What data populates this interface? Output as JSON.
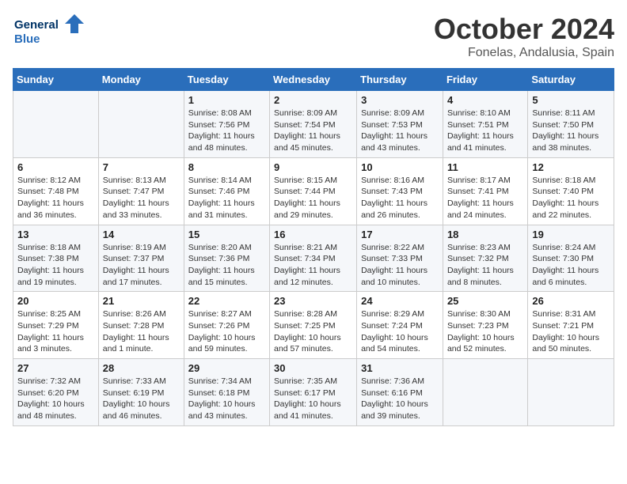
{
  "logo": {
    "line1": "General",
    "line2": "Blue"
  },
  "title": "October 2024",
  "subtitle": "Fonelas, Andalusia, Spain",
  "days_of_week": [
    "Sunday",
    "Monday",
    "Tuesday",
    "Wednesday",
    "Thursday",
    "Friday",
    "Saturday"
  ],
  "weeks": [
    [
      {
        "day": "",
        "info": ""
      },
      {
        "day": "",
        "info": ""
      },
      {
        "day": "1",
        "info": "Sunrise: 8:08 AM\nSunset: 7:56 PM\nDaylight: 11 hours and 48 minutes."
      },
      {
        "day": "2",
        "info": "Sunrise: 8:09 AM\nSunset: 7:54 PM\nDaylight: 11 hours and 45 minutes."
      },
      {
        "day": "3",
        "info": "Sunrise: 8:09 AM\nSunset: 7:53 PM\nDaylight: 11 hours and 43 minutes."
      },
      {
        "day": "4",
        "info": "Sunrise: 8:10 AM\nSunset: 7:51 PM\nDaylight: 11 hours and 41 minutes."
      },
      {
        "day": "5",
        "info": "Sunrise: 8:11 AM\nSunset: 7:50 PM\nDaylight: 11 hours and 38 minutes."
      }
    ],
    [
      {
        "day": "6",
        "info": "Sunrise: 8:12 AM\nSunset: 7:48 PM\nDaylight: 11 hours and 36 minutes."
      },
      {
        "day": "7",
        "info": "Sunrise: 8:13 AM\nSunset: 7:47 PM\nDaylight: 11 hours and 33 minutes."
      },
      {
        "day": "8",
        "info": "Sunrise: 8:14 AM\nSunset: 7:46 PM\nDaylight: 11 hours and 31 minutes."
      },
      {
        "day": "9",
        "info": "Sunrise: 8:15 AM\nSunset: 7:44 PM\nDaylight: 11 hours and 29 minutes."
      },
      {
        "day": "10",
        "info": "Sunrise: 8:16 AM\nSunset: 7:43 PM\nDaylight: 11 hours and 26 minutes."
      },
      {
        "day": "11",
        "info": "Sunrise: 8:17 AM\nSunset: 7:41 PM\nDaylight: 11 hours and 24 minutes."
      },
      {
        "day": "12",
        "info": "Sunrise: 8:18 AM\nSunset: 7:40 PM\nDaylight: 11 hours and 22 minutes."
      }
    ],
    [
      {
        "day": "13",
        "info": "Sunrise: 8:18 AM\nSunset: 7:38 PM\nDaylight: 11 hours and 19 minutes."
      },
      {
        "day": "14",
        "info": "Sunrise: 8:19 AM\nSunset: 7:37 PM\nDaylight: 11 hours and 17 minutes."
      },
      {
        "day": "15",
        "info": "Sunrise: 8:20 AM\nSunset: 7:36 PM\nDaylight: 11 hours and 15 minutes."
      },
      {
        "day": "16",
        "info": "Sunrise: 8:21 AM\nSunset: 7:34 PM\nDaylight: 11 hours and 12 minutes."
      },
      {
        "day": "17",
        "info": "Sunrise: 8:22 AM\nSunset: 7:33 PM\nDaylight: 11 hours and 10 minutes."
      },
      {
        "day": "18",
        "info": "Sunrise: 8:23 AM\nSunset: 7:32 PM\nDaylight: 11 hours and 8 minutes."
      },
      {
        "day": "19",
        "info": "Sunrise: 8:24 AM\nSunset: 7:30 PM\nDaylight: 11 hours and 6 minutes."
      }
    ],
    [
      {
        "day": "20",
        "info": "Sunrise: 8:25 AM\nSunset: 7:29 PM\nDaylight: 11 hours and 3 minutes."
      },
      {
        "day": "21",
        "info": "Sunrise: 8:26 AM\nSunset: 7:28 PM\nDaylight: 11 hours and 1 minute."
      },
      {
        "day": "22",
        "info": "Sunrise: 8:27 AM\nSunset: 7:26 PM\nDaylight: 10 hours and 59 minutes."
      },
      {
        "day": "23",
        "info": "Sunrise: 8:28 AM\nSunset: 7:25 PM\nDaylight: 10 hours and 57 minutes."
      },
      {
        "day": "24",
        "info": "Sunrise: 8:29 AM\nSunset: 7:24 PM\nDaylight: 10 hours and 54 minutes."
      },
      {
        "day": "25",
        "info": "Sunrise: 8:30 AM\nSunset: 7:23 PM\nDaylight: 10 hours and 52 minutes."
      },
      {
        "day": "26",
        "info": "Sunrise: 8:31 AM\nSunset: 7:21 PM\nDaylight: 10 hours and 50 minutes."
      }
    ],
    [
      {
        "day": "27",
        "info": "Sunrise: 7:32 AM\nSunset: 6:20 PM\nDaylight: 10 hours and 48 minutes."
      },
      {
        "day": "28",
        "info": "Sunrise: 7:33 AM\nSunset: 6:19 PM\nDaylight: 10 hours and 46 minutes."
      },
      {
        "day": "29",
        "info": "Sunrise: 7:34 AM\nSunset: 6:18 PM\nDaylight: 10 hours and 43 minutes."
      },
      {
        "day": "30",
        "info": "Sunrise: 7:35 AM\nSunset: 6:17 PM\nDaylight: 10 hours and 41 minutes."
      },
      {
        "day": "31",
        "info": "Sunrise: 7:36 AM\nSunset: 6:16 PM\nDaylight: 10 hours and 39 minutes."
      },
      {
        "day": "",
        "info": ""
      },
      {
        "day": "",
        "info": ""
      }
    ]
  ]
}
